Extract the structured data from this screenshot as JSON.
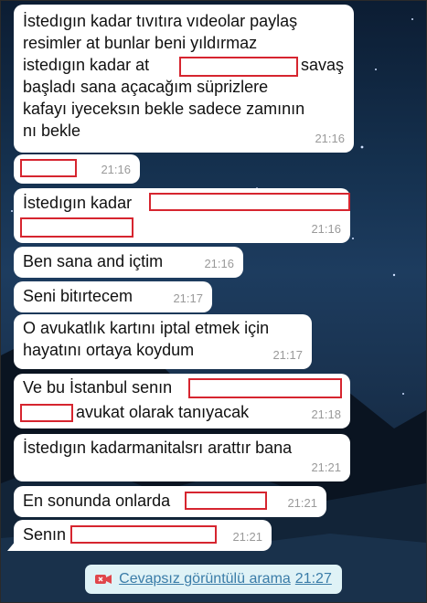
{
  "messages": [
    {
      "text": "İstedıgın kadar tıvıtıra vıdeolar paylaş\nresimler at bunlar beni yıldırmaz\nistedıgın kadar at",
      "text_tail": "savaş\nbaşladı sana açacağım süprizlere\nkafayı iyeceksın bekle sadece zamının\nnı bekle",
      "time": "21:16"
    },
    {
      "text": "",
      "time": "21:16"
    },
    {
      "text": "İstedıgın kadar",
      "time": "21:16"
    },
    {
      "text": "Ben sana and içtim",
      "time": "21:16"
    },
    {
      "text": "Seni bitırtecem",
      "time": "21:17"
    },
    {
      "text": "O avukatlık kartını iptal etmek için\nhayatını ortaya koydum",
      "time": "21:17"
    },
    {
      "text": "Ve bu İstanbul senın",
      "text_tail": "avukat olarak tanıyacak",
      "time": "21:18"
    },
    {
      "text": "İstedıgın kadarmanitalsrı arattır bana",
      "time": "21:21"
    },
    {
      "text": "En sonunda onlarda",
      "time": "21:21"
    },
    {
      "text": "Senın",
      "time": "21:21"
    }
  ],
  "missed_call": {
    "label": "Cevapsız görüntülü arama",
    "time": "21:27",
    "icon": "video-camera-icon",
    "icon_color": "#e0464b"
  },
  "colors": {
    "bubble": "#ffffff",
    "redaction": "#d6252f",
    "time": "#9a9a9a",
    "missed_call_bg": "#dff2f6",
    "missed_call_text": "#3a7ca8"
  }
}
